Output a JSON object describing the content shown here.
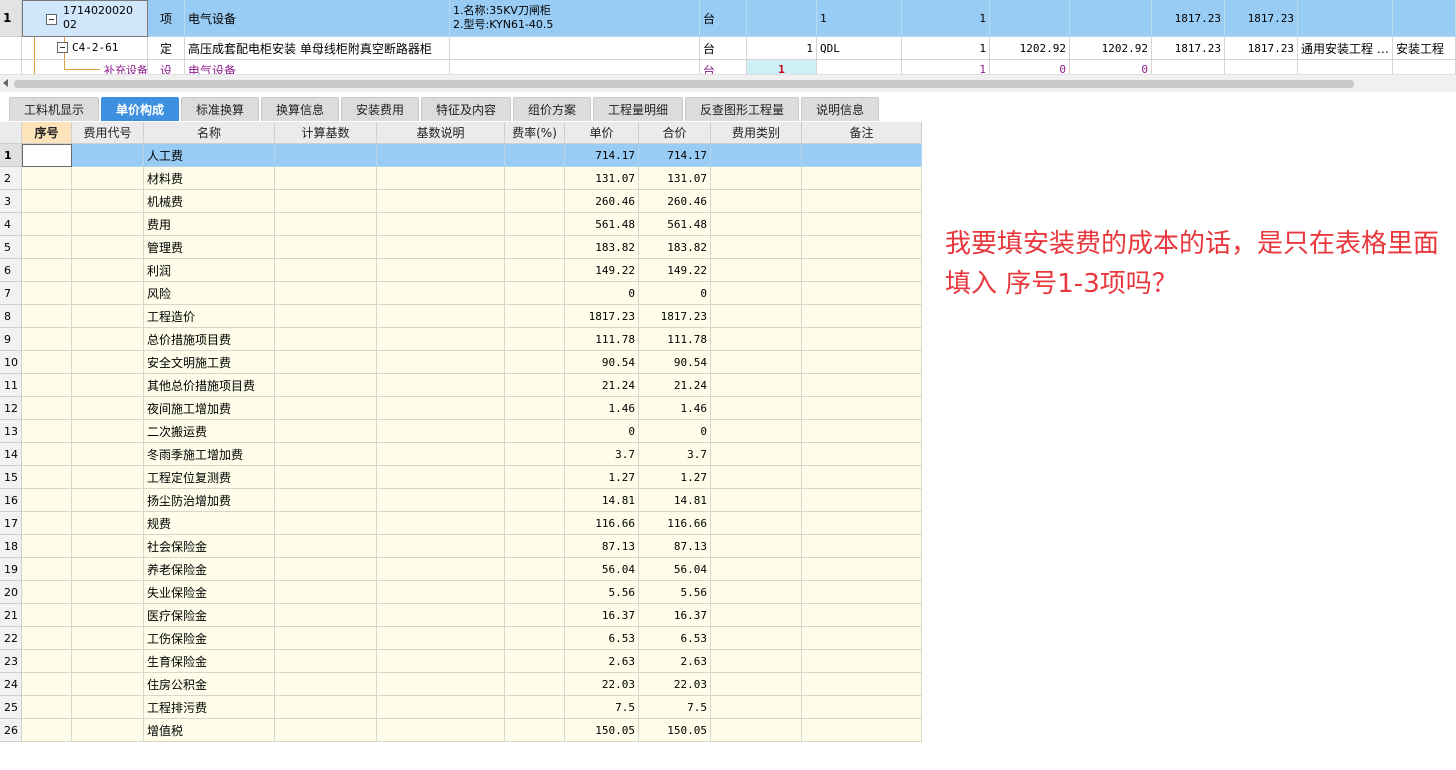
{
  "top_grid": {
    "rows": [
      {
        "row_no": "1",
        "code_line1": "1714020020",
        "code_line2": "02",
        "type": "项",
        "name": "电气设备",
        "feature_line1": "1.名称:35KV刀闸柜",
        "feature_line2": "2.型号:KYN61-40.5",
        "unit": "台",
        "qty_expr": "",
        "expr": "1",
        "qty": "1",
        "price1": "",
        "price2": "",
        "unit_price": "1817.23",
        "total": "1817.23",
        "major": "",
        "category": ""
      },
      {
        "row_no": "",
        "code": "C4-2-61",
        "type": "定",
        "name": "高压成套配电柜安装 单母线柜附真空断路器柜",
        "unit": "台",
        "qty_expr": "1",
        "expr": "QDL",
        "qty": "1",
        "price1": "1202.92",
        "price2": "1202.92",
        "unit_price": "1817.23",
        "total": "1817.23",
        "major": "通用安装工程 …",
        "category": "安装工程"
      },
      {
        "row_no": "",
        "code": "补充设备…",
        "type": "设",
        "name": "电气设备",
        "unit": "台",
        "qty_expr": "1",
        "expr": "",
        "qty": "1",
        "price1": "0",
        "price2": "0",
        "unit_price": "",
        "total": "",
        "major": "",
        "category": ""
      }
    ]
  },
  "tabs": [
    {
      "label": "工料机显示",
      "active": false
    },
    {
      "label": "单价构成",
      "active": true
    },
    {
      "label": "标准换算",
      "active": false
    },
    {
      "label": "换算信息",
      "active": false
    },
    {
      "label": "安装费用",
      "active": false
    },
    {
      "label": "特征及内容",
      "active": false
    },
    {
      "label": "组价方案",
      "active": false
    },
    {
      "label": "工程量明细",
      "active": false
    },
    {
      "label": "反查图形工程量",
      "active": false
    },
    {
      "label": "说明信息",
      "active": false
    }
  ],
  "grid": {
    "headers": [
      "序号",
      "费用代号",
      "名称",
      "计算基数",
      "基数说明",
      "费率(%)",
      "单价",
      "合价",
      "费用类别",
      "备注"
    ],
    "rows": [
      {
        "n": "1",
        "name": "人工费",
        "price": "714.17",
        "total": "714.17"
      },
      {
        "n": "2",
        "name": "材料费",
        "price": "131.07",
        "total": "131.07"
      },
      {
        "n": "3",
        "name": "机械费",
        "price": "260.46",
        "total": "260.46"
      },
      {
        "n": "4",
        "name": "费用",
        "price": "561.48",
        "total": "561.48"
      },
      {
        "n": "5",
        "name": "管理费",
        "price": "183.82",
        "total": "183.82"
      },
      {
        "n": "6",
        "name": "利润",
        "price": "149.22",
        "total": "149.22"
      },
      {
        "n": "7",
        "name": "风险",
        "price": "0",
        "total": "0"
      },
      {
        "n": "8",
        "name": "工程造价",
        "price": "1817.23",
        "total": "1817.23"
      },
      {
        "n": "9",
        "name": "总价措施项目费",
        "price": "111.78",
        "total": "111.78"
      },
      {
        "n": "10",
        "name": "安全文明施工费",
        "price": "90.54",
        "total": "90.54"
      },
      {
        "n": "11",
        "name": "其他总价措施项目费",
        "price": "21.24",
        "total": "21.24"
      },
      {
        "n": "12",
        "name": "夜间施工增加费",
        "price": "1.46",
        "total": "1.46"
      },
      {
        "n": "13",
        "name": "二次搬运费",
        "price": "0",
        "total": "0"
      },
      {
        "n": "14",
        "name": "冬雨季施工增加费",
        "price": "3.7",
        "total": "3.7"
      },
      {
        "n": "15",
        "name": "工程定位复测费",
        "price": "1.27",
        "total": "1.27"
      },
      {
        "n": "16",
        "name": "扬尘防治增加费",
        "price": "14.81",
        "total": "14.81"
      },
      {
        "n": "17",
        "name": "规费",
        "price": "116.66",
        "total": "116.66"
      },
      {
        "n": "18",
        "name": "社会保险金",
        "price": "87.13",
        "total": "87.13"
      },
      {
        "n": "19",
        "name": "养老保险金",
        "price": "56.04",
        "total": "56.04"
      },
      {
        "n": "20",
        "name": "失业保险金",
        "price": "5.56",
        "total": "5.56"
      },
      {
        "n": "21",
        "name": "医疗保险金",
        "price": "16.37",
        "total": "16.37"
      },
      {
        "n": "22",
        "name": "工伤保险金",
        "price": "6.53",
        "total": "6.53"
      },
      {
        "n": "23",
        "name": "生育保险金",
        "price": "2.63",
        "total": "2.63"
      },
      {
        "n": "24",
        "name": "住房公积金",
        "price": "22.03",
        "total": "22.03"
      },
      {
        "n": "25",
        "name": "工程排污费",
        "price": "7.5",
        "total": "7.5"
      },
      {
        "n": "26",
        "name": "增值税",
        "price": "150.05",
        "total": "150.05"
      }
    ]
  },
  "note": {
    "text": "我要填安装费的成本的话，是只在表格里面填入 序号1-3项吗？"
  },
  "colors": {
    "selected_row": "#99ccf5",
    "active_tab": "#3d8fe0",
    "grid_cell": "#fdfde9",
    "annotation": "#e8383d",
    "purple_text": "#8c1c8c"
  }
}
